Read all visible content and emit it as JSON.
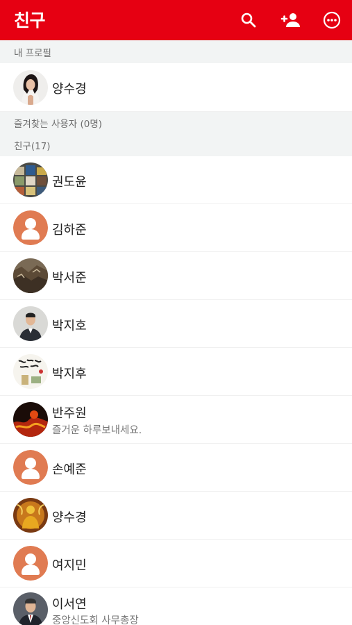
{
  "appbar": {
    "title": "친구",
    "icons": [
      "search-icon",
      "add-friend-icon",
      "more-icon"
    ],
    "color": "#e60012"
  },
  "my_profile": {
    "section_label": "내 프로필",
    "name": "양수경"
  },
  "favorites": {
    "section_label": "즐겨찾는 사용자 (0명)"
  },
  "friends": {
    "section_label": "친구(17)",
    "items": [
      {
        "name": "권도윤",
        "status": "",
        "avatar": "photo-food"
      },
      {
        "name": "김하준",
        "status": "",
        "avatar": "default-person"
      },
      {
        "name": "박서준",
        "status": "",
        "avatar": "photo-landscape"
      },
      {
        "name": "박지호",
        "status": "",
        "avatar": "photo-man-suit"
      },
      {
        "name": "박지후",
        "status": "",
        "avatar": "photo-calligraphy"
      },
      {
        "name": "반주원",
        "status": "즐거운 하루보내세요.",
        "avatar": "photo-fire"
      },
      {
        "name": "손예준",
        "status": "",
        "avatar": "default-person"
      },
      {
        "name": "양수경",
        "status": "",
        "avatar": "photo-buddha"
      },
      {
        "name": "여지민",
        "status": "",
        "avatar": "default-person"
      },
      {
        "name": "이서연",
        "status": "중앙신도회 사무총장",
        "avatar": "photo-man-tie"
      }
    ]
  }
}
